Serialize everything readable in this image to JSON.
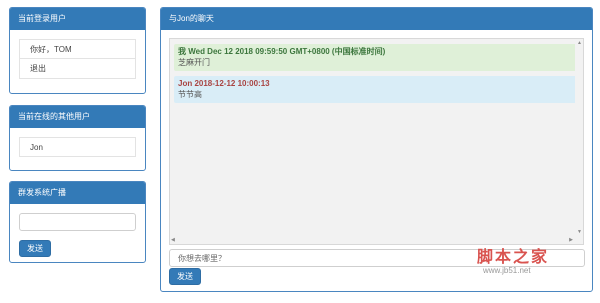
{
  "login_panel": {
    "title": "当前登录用户",
    "greeting": "你好，TOM",
    "logout": "退出"
  },
  "online_panel": {
    "title": "当前在线的其他用户",
    "users": [
      "Jon"
    ]
  },
  "broadcast_panel": {
    "title": "群发系统广播",
    "input_value": "",
    "send_label": "发送"
  },
  "chat_panel": {
    "title": "与Jon的聊天",
    "messages": [
      {
        "type": "self",
        "header": "我 Wed Dec 12 2018 09:59:50 GMT+0800 (中国标准时间)",
        "text": "芝麻开门"
      },
      {
        "type": "other",
        "header": "Jon 2018-12-12 10:00:13",
        "text": "节节高"
      }
    ],
    "input_placeholder": "你想去哪里？",
    "send_label": "发送"
  },
  "watermark": {
    "text": "脚本之家",
    "url": "www.jb51.net"
  },
  "colors": {
    "primary": "#337ab7",
    "self_message_bg": "#dff0d8",
    "other_message_bg": "#d9edf7",
    "watermark": "#d9534f"
  }
}
